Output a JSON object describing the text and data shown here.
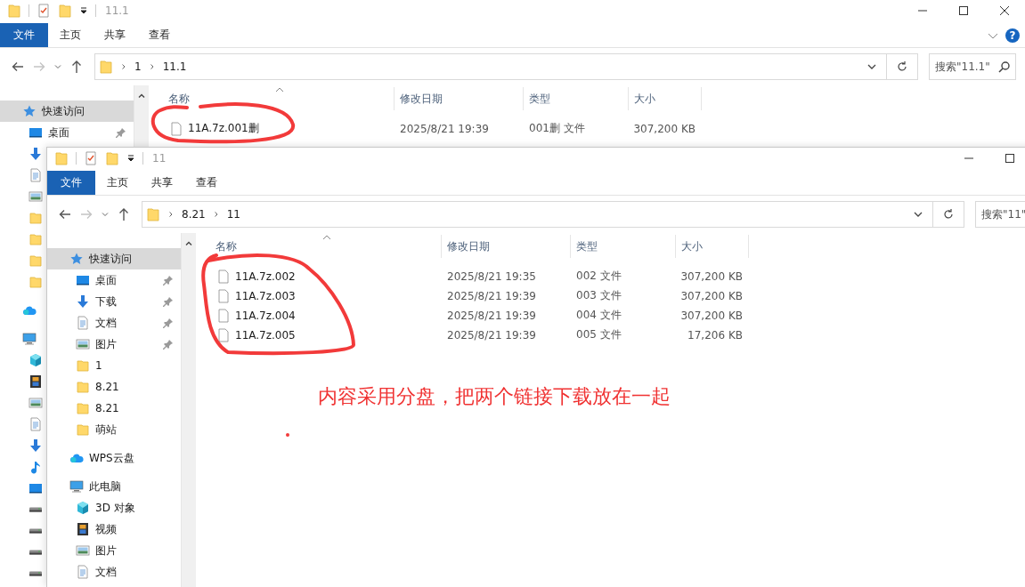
{
  "windows": [
    {
      "title": "11.1",
      "controls": [
        {
          "kind": "minimize"
        },
        {
          "kind": "maximize"
        },
        {
          "kind": "close"
        }
      ],
      "ribbon_toggle": true,
      "help": "?",
      "tabs": [
        {
          "label": "文件",
          "selected": true
        },
        {
          "label": "主页",
          "selected": false
        },
        {
          "label": "共享",
          "selected": false
        },
        {
          "label": "查看",
          "selected": false
        }
      ],
      "breadcrumbs": [
        "1",
        "11.1"
      ],
      "search": {
        "placeholder": "搜索\"11.1\""
      },
      "sidebar": [
        {
          "label": "快速访问",
          "kind": "star",
          "selected": true,
          "pinned": false,
          "children": [
            {
              "label": "桌面",
              "kind": "desktop",
              "selected": false,
              "pinned": true
            },
            {
              "kind": "download"
            },
            {
              "kind": "document"
            },
            {
              "kind": "picture"
            },
            {
              "kind": "folder"
            },
            {
              "kind": "folder"
            },
            {
              "kind": "folder"
            },
            {
              "kind": "folder"
            }
          ]
        },
        {
          "kind": "cloud"
        },
        {
          "kind": "computer",
          "children": [
            {
              "kind": "cube"
            },
            {
              "kind": "film"
            },
            {
              "kind": "picture"
            },
            {
              "kind": "document"
            },
            {
              "kind": "download"
            },
            {
              "kind": "music"
            },
            {
              "kind": "desktop"
            },
            {
              "kind": "drive"
            },
            {
              "kind": "drive"
            },
            {
              "kind": "drive"
            },
            {
              "kind": "drive"
            }
          ]
        }
      ],
      "columns": [
        "名称",
        "修改日期",
        "类型",
        "大小"
      ],
      "files": [
        {
          "name": "11A.7z.001删",
          "modified": "2025/8/21 19:39",
          "type": "001删 文件",
          "size": "307,200 KB"
        }
      ]
    },
    {
      "title": "11",
      "controls": [
        {
          "kind": "minimize"
        },
        {
          "kind": "maximize"
        }
      ],
      "tabs": [
        {
          "label": "文件",
          "selected": true
        },
        {
          "label": "主页",
          "selected": false
        },
        {
          "label": "共享",
          "selected": false
        },
        {
          "label": "查看",
          "selected": false
        }
      ],
      "breadcrumbs": [
        "8.21",
        "11"
      ],
      "search": {
        "placeholder": "搜索\"11\""
      },
      "sidebar": [
        {
          "label": "快速访问",
          "kind": "star",
          "selected": true,
          "pinned": false,
          "children": [
            {
              "label": "桌面",
              "kind": "desktop",
              "selected": false,
              "pinned": true
            },
            {
              "label": "下载",
              "kind": "download",
              "selected": false,
              "pinned": true
            },
            {
              "label": "文档",
              "kind": "document",
              "selected": false,
              "pinned": true
            },
            {
              "label": "图片",
              "kind": "picture",
              "selected": false,
              "pinned": true
            },
            {
              "label": "1",
              "kind": "folder",
              "selected": false,
              "pinned": false
            },
            {
              "label": "8.21",
              "kind": "folder",
              "selected": false,
              "pinned": false
            },
            {
              "label": "8.21",
              "kind": "folder",
              "selected": false,
              "pinned": false
            },
            {
              "label": "萌站",
              "kind": "folder",
              "selected": false,
              "pinned": false
            }
          ]
        },
        {
          "label": "WPS云盘",
          "kind": "cloud",
          "selected": false,
          "pinned": false
        },
        {
          "label": "此电脑",
          "kind": "computer",
          "selected": false,
          "pinned": false,
          "children": [
            {
              "label": "3D 对象",
              "kind": "cube",
              "selected": false,
              "pinned": false
            },
            {
              "label": "视频",
              "kind": "film",
              "selected": false,
              "pinned": false
            },
            {
              "label": "图片",
              "kind": "picture",
              "selected": false,
              "pinned": false
            },
            {
              "label": "文档",
              "kind": "document",
              "selected": false,
              "pinned": false
            }
          ]
        }
      ],
      "columns": [
        "名称",
        "修改日期",
        "类型",
        "大小"
      ],
      "files": [
        {
          "name": "11A.7z.002",
          "modified": "2025/8/21 19:35",
          "type": "002 文件",
          "size": "307,200 KB"
        },
        {
          "name": "11A.7z.003",
          "modified": "2025/8/21 19:39",
          "type": "003 文件",
          "size": "307,200 KB"
        },
        {
          "name": "11A.7z.004",
          "modified": "2025/8/21 19:39",
          "type": "004 文件",
          "size": "307,200 KB"
        },
        {
          "name": "11A.7z.005",
          "modified": "2025/8/21 19:39",
          "type": "005 文件",
          "size": "17,206 KB"
        }
      ]
    }
  ],
  "annotations": {
    "note": "内容采用分盘，把两个链接下载放在一起",
    "marks": [
      {
        "kind": "loop"
      },
      {
        "kind": "loop"
      },
      {
        "kind": "dot"
      }
    ]
  }
}
